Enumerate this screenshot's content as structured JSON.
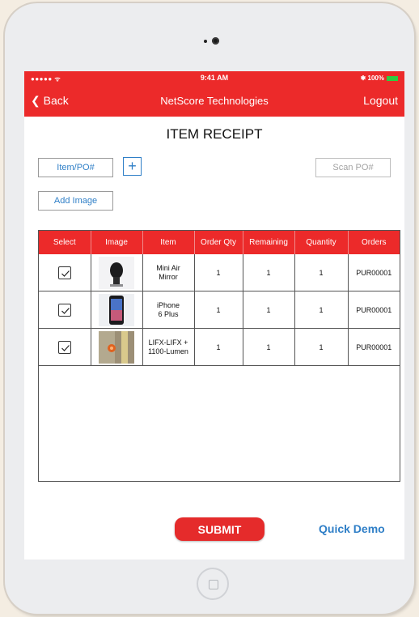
{
  "status_bar": {
    "signal": "●●●●● ᯤ",
    "time": "9:41 AM",
    "battery_text": "✱ 100%"
  },
  "nav": {
    "back_label": "❮ Back",
    "title": "NetScore Technologies",
    "logout_label": "Logout"
  },
  "page": {
    "title": "ITEM RECEIPT"
  },
  "controls": {
    "item_po_label": "Item/PO#",
    "add_icon": "+",
    "scan_po_label": "Scan PO#",
    "add_image_label": "Add Image"
  },
  "table": {
    "headers": [
      "Select",
      "Image",
      "Item",
      "Order Qty",
      "Remaining",
      "Quantity",
      "Orders"
    ],
    "rows": [
      {
        "checked": true,
        "image": "mini-air-mirror-thumbnail",
        "item_line1": "Mini Air",
        "item_line2": "Mirror",
        "order_qty": "1",
        "remaining": "1",
        "quantity": "1",
        "order": "PUR00001"
      },
      {
        "checked": true,
        "image": "iphone-thumbnail",
        "item_line1": "iPhone",
        "item_line2": "6 Plus",
        "order_qty": "1",
        "remaining": "1",
        "quantity": "1",
        "order": "PUR00001"
      },
      {
        "checked": true,
        "image": "lifx-bulb-thumbnail",
        "item_line1": "LIFX-LIFX +",
        "item_line2": "1100-Lumen",
        "order_qty": "1",
        "remaining": "1",
        "quantity": "1",
        "order": "PUR00001"
      }
    ]
  },
  "actions": {
    "submit_label": "SUBMIT",
    "quick_demo_label": "Quick Demo"
  },
  "colors": {
    "brand_red": "#ec2a2a",
    "link_blue": "#2f7fc7"
  }
}
